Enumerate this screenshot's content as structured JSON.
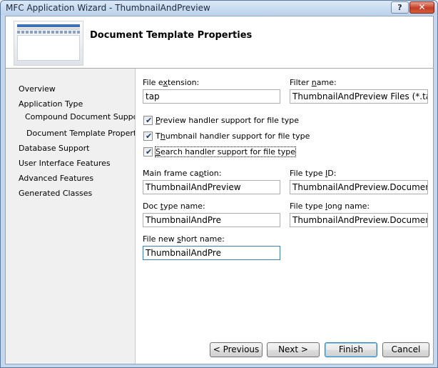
{
  "window": {
    "title": "MFC Application Wizard - ThumbnailAndPreview",
    "help_glyph": "?",
    "close_glyph": "✕"
  },
  "header": {
    "title": "Document Template Properties"
  },
  "sidebar": {
    "items": [
      {
        "label": "Overview"
      },
      {
        "label": "Application Type"
      },
      {
        "label": "Compound Document Support"
      },
      {
        "label": "Document Template Properties"
      },
      {
        "label": "Database Support"
      },
      {
        "label": "User Interface Features"
      },
      {
        "label": "Advanced Features"
      },
      {
        "label": "Generated Classes"
      }
    ]
  },
  "form": {
    "file_extension": {
      "label_pre": "File e",
      "label_acc": "x",
      "label_post": "tension:",
      "value": "tap"
    },
    "filter_name": {
      "label_pre": "Filter ",
      "label_acc": "n",
      "label_post": "ame:",
      "value": "ThumbnailAndPreview Files (*.tap)"
    },
    "checkboxes": [
      {
        "label_pre": "",
        "label_acc": "P",
        "label_post": "review handler support for file type",
        "checked": true
      },
      {
        "label_pre": "T",
        "label_acc": "h",
        "label_post": "umbnail handler support for file type",
        "checked": true
      },
      {
        "label_pre": "",
        "label_acc": "S",
        "label_post": "earch handler support for file type",
        "checked": true
      }
    ],
    "main_frame_caption": {
      "label_pre": "Main frame ca",
      "label_acc": "p",
      "label_post": "tion:",
      "value": "ThumbnailAndPreview"
    },
    "file_type_id": {
      "label_pre": "File type ",
      "label_acc": "I",
      "label_post": "D:",
      "value": "ThumbnailAndPreview.Document"
    },
    "doc_type_name": {
      "label_pre": "Doc ",
      "label_acc": "t",
      "label_post": "ype name:",
      "value": "ThumbnailAndPre"
    },
    "file_type_long_name": {
      "label_pre": "File type ",
      "label_acc": "l",
      "label_post": "ong name:",
      "value": "ThumbnailAndPreview.Document"
    },
    "file_new_short_name": {
      "label_pre": "File new ",
      "label_acc": "s",
      "label_post": "hort name:",
      "value": "ThumbnailAndPre"
    }
  },
  "buttons": {
    "previous": "< Previous",
    "next": "Next >",
    "finish": "Finish",
    "cancel": "Cancel"
  }
}
